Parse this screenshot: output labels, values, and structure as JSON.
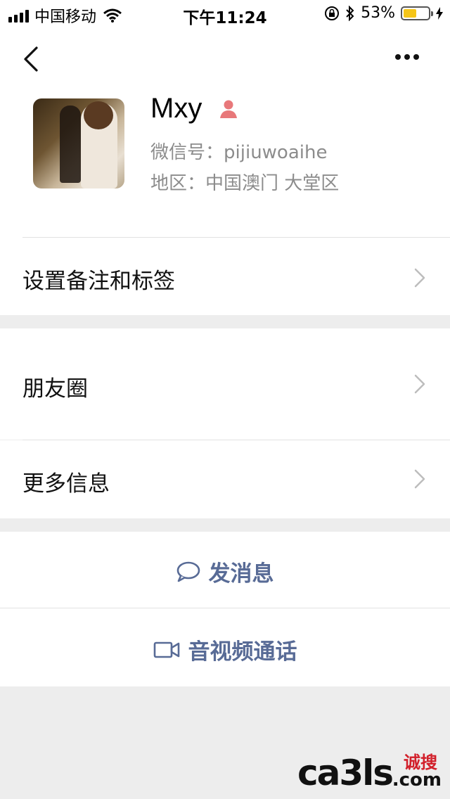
{
  "status_bar": {
    "carrier": "中国移动",
    "time": "下午11:24",
    "battery_percent": "53%",
    "battery_level": 0.53,
    "battery_color": "#f5c518"
  },
  "nav": {
    "back_icon": "chevron-left-icon",
    "more_icon": "more-dots-icon"
  },
  "profile": {
    "name": "Mxy",
    "gender_icon": "female-user-icon",
    "gender_color": "#e8787a",
    "wechat_id_label": "微信号：",
    "wechat_id": "pijiuwoaihe",
    "region_label": "地区：",
    "region": "中国澳门 大堂区"
  },
  "menu": {
    "remark_tags": "设置备注和标签",
    "moments": "朋友圈",
    "more_info": "更多信息"
  },
  "actions": {
    "message": "发消息",
    "video_call": "音视频通话",
    "accent_color": "#586b96"
  },
  "watermark": {
    "text_main": "ca3ls",
    "text_side": "诚搜",
    "text_domain": ".com"
  }
}
